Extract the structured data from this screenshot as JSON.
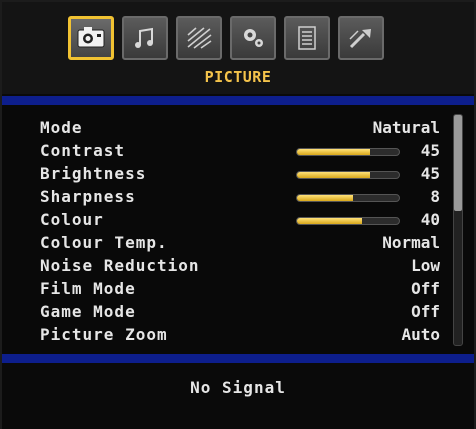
{
  "header": {
    "tabs": [
      {
        "icon": "picture-icon",
        "active": true
      },
      {
        "icon": "sound-icon",
        "active": false
      },
      {
        "icon": "settings-icon",
        "active": false
      },
      {
        "icon": "features-icon",
        "active": false
      },
      {
        "icon": "source-icon",
        "active": false
      },
      {
        "icon": "install-icon",
        "active": false
      }
    ],
    "active_tab_label": "PICTURE"
  },
  "menu": {
    "items": [
      {
        "label": "Mode",
        "value": "Natural"
      },
      {
        "label": "Contrast",
        "value": "45",
        "level": 0.72
      },
      {
        "label": "Brightness",
        "value": "45",
        "level": 0.72
      },
      {
        "label": "Sharpness",
        "value": "8",
        "level": 0.55
      },
      {
        "label": "Colour",
        "value": "40",
        "level": 0.64
      },
      {
        "label": "Colour Temp.",
        "value": "Normal"
      },
      {
        "label": "Noise Reduction",
        "value": "Low"
      },
      {
        "label": "Film Mode",
        "value": "Off"
      },
      {
        "label": "Game Mode",
        "value": "Off"
      },
      {
        "label": "Picture Zoom",
        "value": "Auto"
      }
    ]
  },
  "status": {
    "text": "No Signal"
  },
  "colors": {
    "accent": "#f4c34b",
    "divider": "#0d1e8c",
    "background": "#0a0a0a"
  }
}
